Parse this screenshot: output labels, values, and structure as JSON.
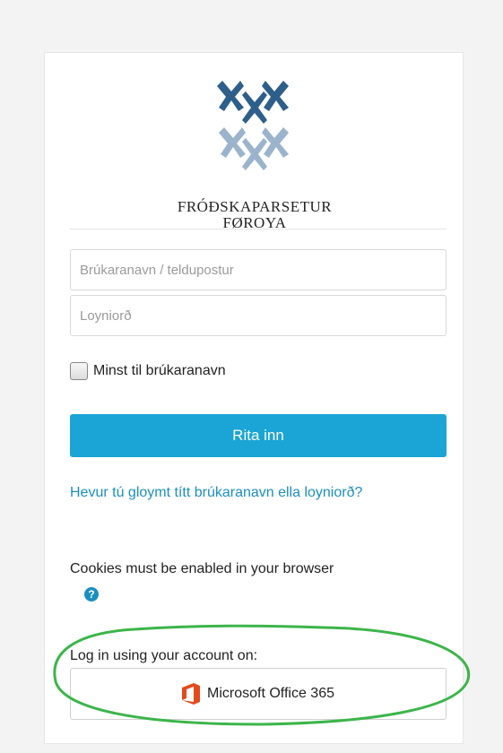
{
  "organization": {
    "name_line1": "FRÓÐSKAPARSETUR",
    "name_line2": "FØROYA"
  },
  "login_form": {
    "username_placeholder": "Brúkaranavn / teldupostur",
    "password_placeholder": "Loyniorð",
    "remember_label": "Minst til brúkaranavn",
    "login_button": "Rita inn",
    "forgot_link": "Hevur tú gloymt títt brúkaranavn ella loyniorð?",
    "cookies_notice": "Cookies must be enabled in your browser",
    "help_icon_glyph": "?"
  },
  "identity_providers": {
    "heading": "Log in using your account on:",
    "providers": [
      {
        "label": "Microsoft Office 365",
        "icon": "office-365-icon"
      }
    ]
  },
  "colors": {
    "accent": "#1aa5d6",
    "link": "#1a8fbf",
    "logo_dark": "#2d5f8a",
    "logo_light": "#9bb4cc",
    "office_orange": "#e34a1b",
    "annotation_green": "#3cb54a"
  }
}
